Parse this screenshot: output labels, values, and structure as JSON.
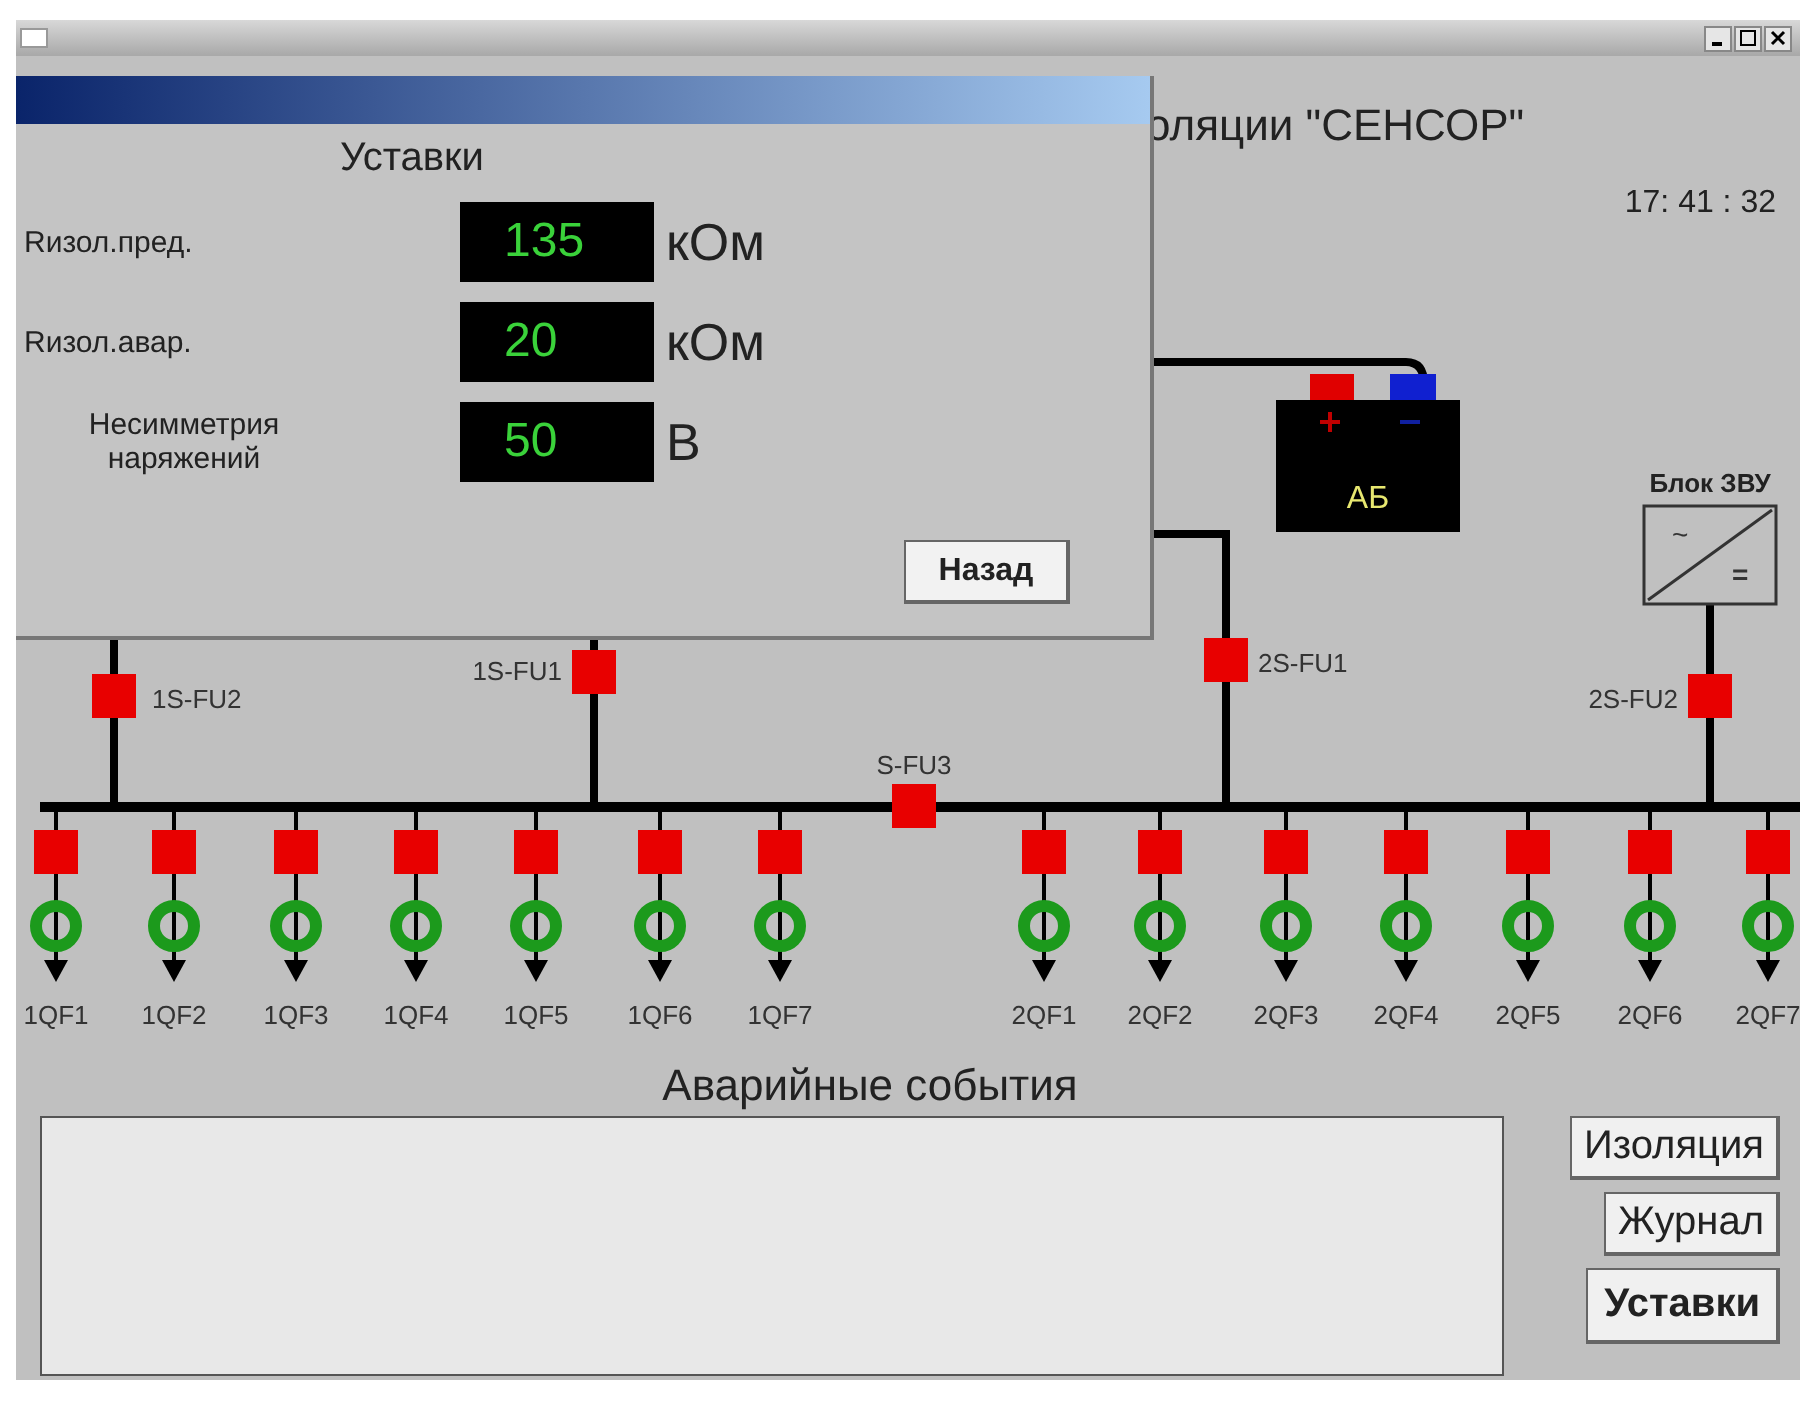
{
  "heading": "оляции \"СЕНСОР\"",
  "clock": "17: 41 : 32",
  "schematic": {
    "battery": {
      "label": "АБ"
    },
    "charger": {
      "label": "Блок ЗВУ",
      "ac_sign": "~",
      "dc_sign": "="
    },
    "fuses": [
      {
        "label": "1S-FU2"
      },
      {
        "label": "1S-FU1"
      },
      {
        "label": "S-FU3"
      },
      {
        "label": "2S-FU1"
      },
      {
        "label": "2S-FU2"
      }
    ],
    "feeder_groups": [
      {
        "feeders": [
          {
            "label": "1QF1"
          },
          {
            "label": "1QF2"
          },
          {
            "label": "1QF3"
          },
          {
            "label": "1QF4"
          },
          {
            "label": "1QF5"
          },
          {
            "label": "1QF6"
          },
          {
            "label": "1QF7"
          }
        ]
      },
      {
        "feeders": [
          {
            "label": "2QF1"
          },
          {
            "label": "2QF2"
          },
          {
            "label": "2QF3"
          },
          {
            "label": "2QF4"
          },
          {
            "label": "2QF5"
          },
          {
            "label": "2QF6"
          },
          {
            "label": "2QF7"
          }
        ]
      }
    ]
  },
  "settings_dialog": {
    "title": "Уставки",
    "rows": [
      {
        "label": "Rизол.пред.",
        "value": "135",
        "unit": "кОм"
      },
      {
        "label": "Rизол.авар.",
        "value": "20",
        "unit": "кОм"
      },
      {
        "label": "Несимметрия наряжений",
        "value": "50",
        "unit": "В"
      }
    ],
    "back_button": "Назад"
  },
  "events": {
    "title": "Аварийные события"
  },
  "buttons": [
    {
      "label": "Изоляция",
      "selected": false
    },
    {
      "label": "Журнал",
      "selected": false
    },
    {
      "label": "Уставки",
      "selected": true
    }
  ]
}
